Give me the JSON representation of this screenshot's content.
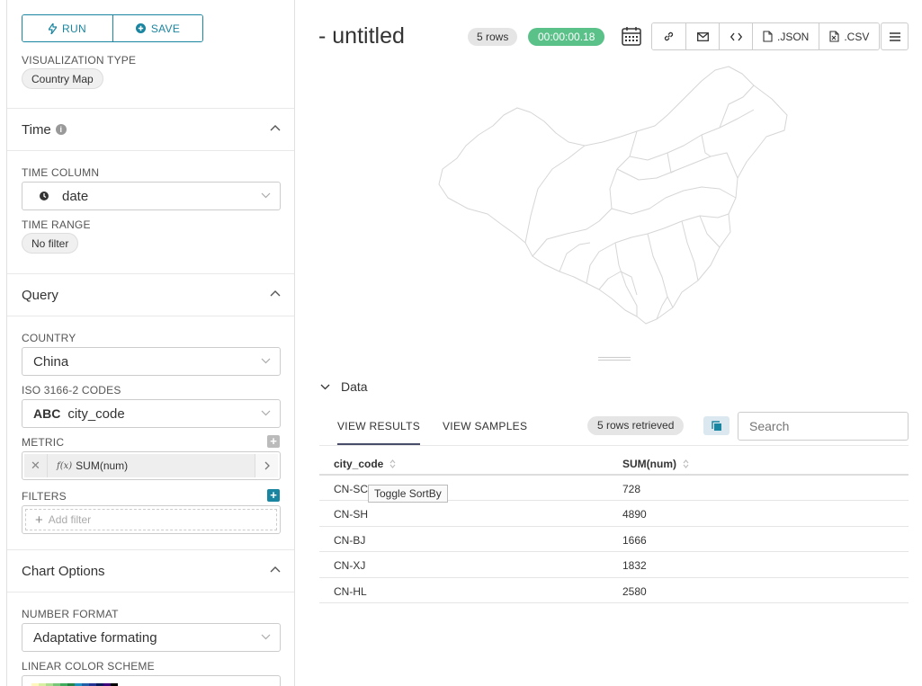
{
  "toolbar_left": {
    "run_label": "RUN",
    "save_label": "SAVE"
  },
  "viz_type": {
    "label": "VISUALIZATION TYPE",
    "value": "Country Map"
  },
  "sections": {
    "time": {
      "title": "Time",
      "time_column_label": "TIME COLUMN",
      "time_column_value": "date",
      "time_range_label": "TIME RANGE",
      "time_range_value": "No filter"
    },
    "query": {
      "title": "Query",
      "country_label": "COUNTRY",
      "country_value": "China",
      "iso_label": "ISO 3166-2 CODES",
      "iso_type": "ABC",
      "iso_value": "city_code",
      "metric_label": "METRIC",
      "metric_value": "SUM(num)",
      "metric_fx": "f(x)",
      "filters_label": "FILTERS",
      "add_filter": "Add filter"
    },
    "chart_options": {
      "title": "Chart Options",
      "number_format_label": "NUMBER FORMAT",
      "number_format_value": "Adaptative formating",
      "color_scheme_label": "LINEAR COLOR SCHEME",
      "color_scheme_colors": [
        "#fff7bc",
        "#d9f0a3",
        "#addd8e",
        "#78c679",
        "#41ab5d",
        "#238443",
        "#1d91c0",
        "#225ea8",
        "#253494",
        "#081d58",
        "#3f007d",
        "#000000"
      ]
    }
  },
  "header": {
    "title": "- untitled",
    "rows_badge": "5 rows",
    "timer": "00:00:00.18",
    "json_label": ".JSON",
    "csv_label": ".CSV"
  },
  "data_pane": {
    "title": "Data",
    "tab_results": "VIEW RESULTS",
    "tab_samples": "VIEW SAMPLES",
    "rows_retrieved": "5 rows retrieved",
    "search_placeholder": "Search",
    "columns": [
      "city_code",
      "SUM(num)"
    ],
    "rows": [
      [
        "CN-SC",
        "728"
      ],
      [
        "CN-SH",
        "4890"
      ],
      [
        "CN-BJ",
        "1666"
      ],
      [
        "CN-XJ",
        "1832"
      ],
      [
        "CN-HL",
        "2580"
      ]
    ],
    "tooltip": "Toggle SortBy"
  },
  "colors": {
    "accent": "#1a85a0",
    "success": "#5ac189",
    "filter_add": "#1a85a0"
  }
}
